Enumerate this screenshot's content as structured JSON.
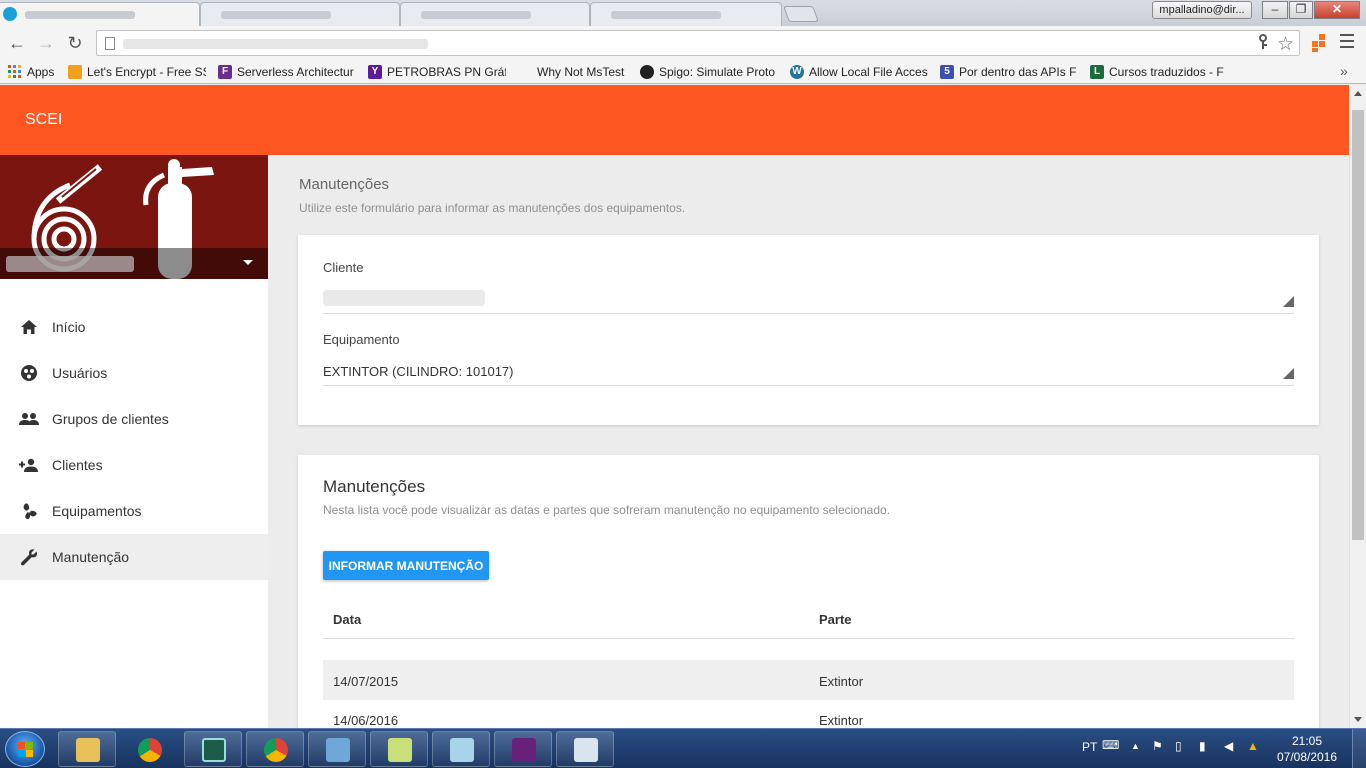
{
  "browser": {
    "account_label": "mpalladino@dir...",
    "window_buttons": [
      "–",
      "❐",
      "✕"
    ],
    "bookmarks": [
      {
        "label": "Apps",
        "icon": "apps-grid-icon",
        "color": "#e44d26"
      },
      {
        "label": "Let's Encrypt - Free SS",
        "icon": "lets-encrypt-icon",
        "color": "#f0a01b"
      },
      {
        "label": "Serverless Architectur",
        "icon": "serverless-icon",
        "color": "#6a2c91"
      },
      {
        "label": "PETROBRAS PN Gráfic",
        "icon": "yahoo-icon",
        "color": "#5b1c98"
      },
      {
        "label": "Why Not MsTest",
        "icon": "",
        "color": ""
      },
      {
        "label": "Spigo: Simulate Proto",
        "icon": "github-icon",
        "color": "#222222"
      },
      {
        "label": "Allow Local File Acces",
        "icon": "wordpress-icon",
        "color": "#21759b"
      },
      {
        "label": "Por dentro das APIs F",
        "icon": "html5-icon",
        "color": "#3c4fb3"
      },
      {
        "label": "Cursos traduzidos - F",
        "icon": "lynda-icon",
        "color": "#1c6b3a"
      }
    ]
  },
  "app": {
    "title": "SCEI",
    "brand_color": "#ff5722",
    "primary_color": "#2196f3",
    "nav": [
      {
        "label": "Início",
        "icon": "home-icon"
      },
      {
        "label": "Usuários",
        "icon": "users-circle-icon"
      },
      {
        "label": "Grupos de clientes",
        "icon": "group-icon"
      },
      {
        "label": "Clientes",
        "icon": "person-add-icon"
      },
      {
        "label": "Equipamentos",
        "icon": "fan-icon"
      },
      {
        "label": "Manutenção",
        "icon": "wrench-icon",
        "active": true
      }
    ]
  },
  "page": {
    "title": "Manutenções",
    "subtitle": "Utilize este formulário para informar as manutenções dos equipamentos.",
    "form": {
      "client_label": "Cliente",
      "client_value": "",
      "equipment_label": "Equipamento",
      "equipment_value": "EXTINTOR (CILINDRO: 101017)"
    },
    "list": {
      "title": "Manutenções",
      "subtitle": "Nesta lista você pode visualizar as datas e partes que sofreram manutenção no equipamento selecionado.",
      "button_label": "INFORMAR MANUTENÇÃO",
      "columns": [
        "Data",
        "Parte"
      ],
      "rows": [
        {
          "date": "14/07/2015",
          "part": "Extintor"
        },
        {
          "date": "14/06/2016",
          "part": "Extintor"
        }
      ]
    }
  },
  "taskbar": {
    "language": "PT",
    "time": "21:05",
    "date": "07/08/2016",
    "apps": [
      "file-explorer-icon",
      "chrome-icon",
      "terminal-icon",
      "chrome-icon",
      "control-panel-icon",
      "notepad-plus-icon",
      "notepad-icon",
      "visual-studio-icon",
      "paint-icon"
    ]
  }
}
